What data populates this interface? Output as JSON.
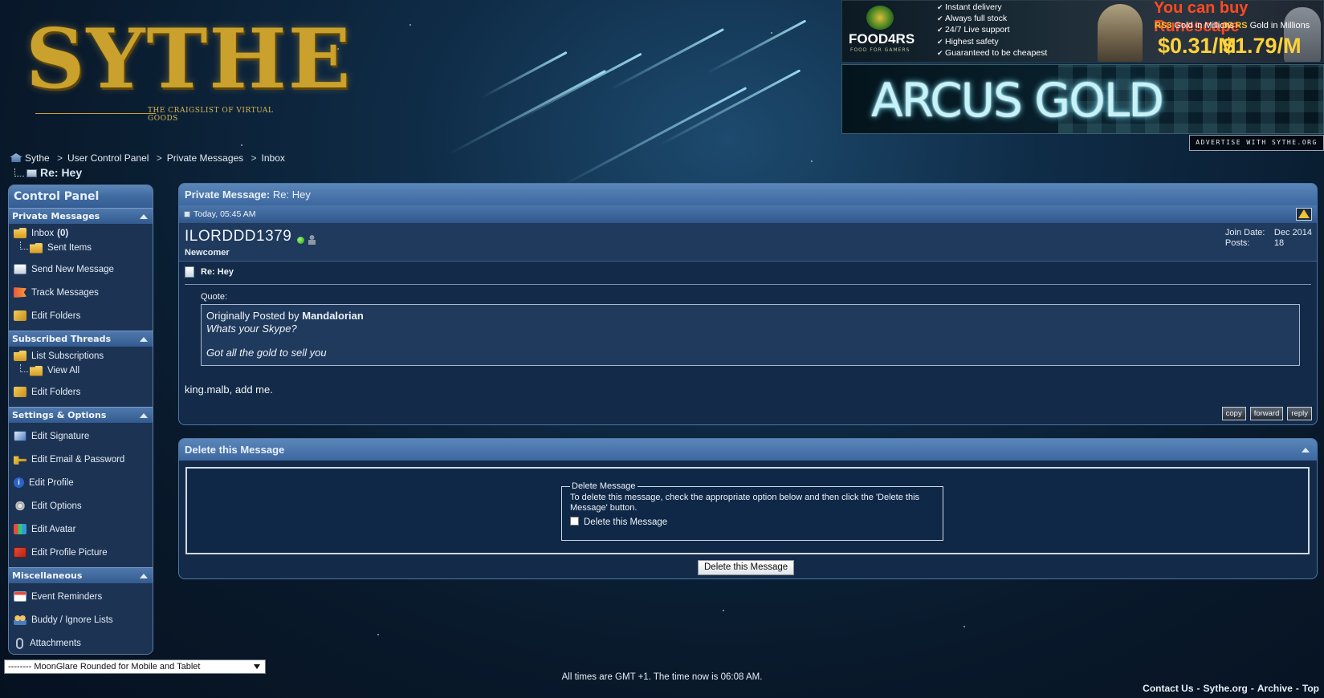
{
  "header": {
    "logo_text": "SYTHE",
    "logo_tagline": "THE CRAIGSLIST OF VIRTUAL GOODS",
    "ads": {
      "food4rs": {
        "brand": "FOOD4RS",
        "brand_sub": "FOOD FOR GAMERS",
        "features": [
          "Instant delivery",
          "Always full stock",
          "24/7 Live support",
          "Highest safety",
          "Guaranteed to be cheapest"
        ],
        "headline": "You can buy Runescape",
        "rs3_label": "RS3",
        "rs3_unit": "Gold in Millions",
        "rs3_price": "$0.31/M",
        "os_label": "07 RS",
        "os_unit": "Gold in Millions",
        "os_price": "$1.79/M"
      },
      "arcus": {
        "text": "ARCUS GOLD"
      },
      "advertise_label": "ADVERTISE WITH SYTHE.ORG"
    }
  },
  "breadcrumb": {
    "items": [
      "Sythe",
      "User Control Panel",
      "Private Messages",
      "Inbox"
    ],
    "separator": ">",
    "current": "Re: Hey"
  },
  "sidebar": {
    "title": "Control Panel",
    "sections": {
      "private_messages": {
        "label": "Private Messages",
        "inbox_label": "Inbox",
        "inbox_count": "(0)",
        "sent_items": "Sent Items",
        "send_new": "Send New Message",
        "track": "Track Messages",
        "edit_folders": "Edit Folders"
      },
      "subscribed_threads": {
        "label": "Subscribed Threads",
        "list_subscriptions": "List Subscriptions",
        "view_all": "View All",
        "edit_folders": "Edit Folders"
      },
      "settings": {
        "label": "Settings & Options",
        "edit_signature": "Edit Signature",
        "edit_email": "Edit Email & Password",
        "edit_profile": "Edit Profile",
        "edit_options": "Edit Options",
        "edit_avatar": "Edit Avatar",
        "edit_profile_picture": "Edit Profile Picture"
      },
      "misc": {
        "label": "Miscellaneous",
        "event_reminders": "Event Reminders",
        "buddy_lists": "Buddy / Ignore Lists",
        "attachments": "Attachments"
      }
    }
  },
  "message": {
    "panel_label": "Private Message:",
    "panel_subject": "Re: Hey",
    "date": "Today, 05:45 AM",
    "username": "ILORDDD1379",
    "user_title": "Newcomer",
    "join_date_label": "Join Date:",
    "join_date": "Dec 2014",
    "posts_label": "Posts:",
    "posts": "18",
    "title": "Re: Hey",
    "quote_label": "Quote:",
    "quote_prefix": "Originally Posted by",
    "quote_author": "Mandalorian",
    "quote_line1": "Whats your Skype?",
    "quote_line2": "Got all the gold to sell you",
    "body": "king.malb, add me.",
    "actions": {
      "copy": "copy",
      "forward": "forward",
      "reply": "reply"
    }
  },
  "delete": {
    "heading": "Delete this Message",
    "legend": "Delete Message",
    "instructions": "To delete this message, check the appropriate option below and then click the 'Delete this Message' button.",
    "checkbox_label": "Delete this Message",
    "button": "Delete this Message"
  },
  "footer": {
    "style_selected": "-------- MoonGlare Rounded for Mobile and Tablet",
    "time_note": "All times are GMT +1. The time now is 06:08 AM.",
    "links": [
      "Contact Us",
      "Sythe.org",
      "Archive",
      "Top"
    ]
  },
  "colors": {
    "panel_header": "#4a76ab",
    "panel_body": "#132a48",
    "sidebar_body": "#1c3354",
    "logo_gold": "#c9a12c",
    "ad_headline": "#ff4a22"
  }
}
